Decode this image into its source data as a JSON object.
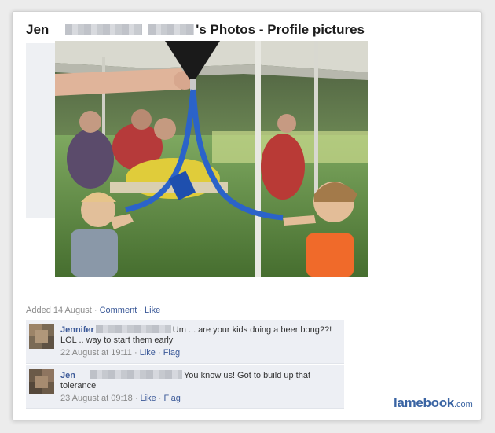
{
  "header": {
    "name_first": "Jen",
    "title_suffix": "'s Photos - Profile pictures"
  },
  "photo": {
    "caption_added": "Added 14 August",
    "comment_link": "Comment",
    "like_link": "Like",
    "separator": " · "
  },
  "comments": [
    {
      "author": "Jennifer",
      "text_inline": "Um ... are your kids doing a beer bong??!",
      "text_rest": "LOL .. way to start them early",
      "timestamp": "22 August at 19:11",
      "like": "Like",
      "flag": "Flag"
    },
    {
      "author": "Jen",
      "text_inline": "You know us! Got to build up that",
      "text_rest": "tolerance",
      "timestamp": "23 August at 09:18",
      "like": "Like",
      "flag": "Flag"
    }
  ],
  "watermark": {
    "brand": "lamebook",
    "suffix": ".com"
  },
  "colors": {
    "link": "#3b5998",
    "comment_bg": "#edeff4",
    "brand": "#3a64a3"
  }
}
